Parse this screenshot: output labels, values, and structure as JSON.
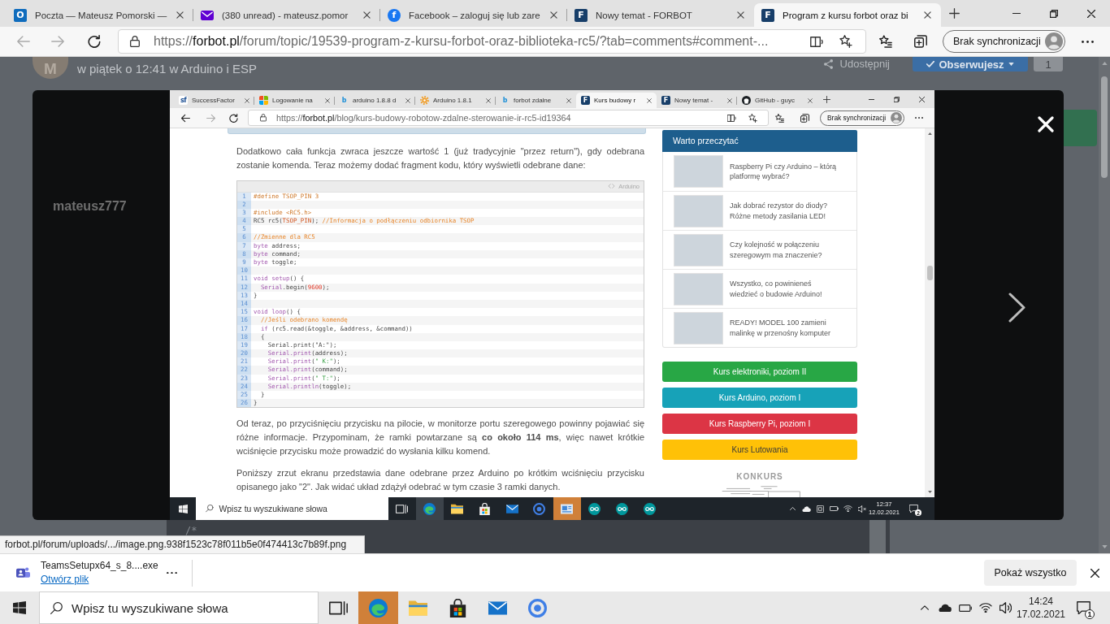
{
  "browser": {
    "tabs": [
      {
        "kind": "o-tile",
        "badge": "O",
        "title": "Poczta — Mateusz Pomorski —",
        "selected": false
      },
      {
        "kind": "envelope",
        "title": "(380 unread) - mateusz.pomor",
        "selected": false
      },
      {
        "kind": "f-circle",
        "badge": "f",
        "title": "Facebook – zaloguj się lub zare",
        "selected": false
      },
      {
        "kind": "f-tile",
        "badge": "F",
        "title": "Nowy temat - FORBOT",
        "selected": false
      },
      {
        "kind": "f-tile",
        "badge": "F",
        "title": "Program z kursu forbot oraz bi",
        "selected": true
      }
    ],
    "nav": [
      {
        "kind": "back",
        "disabled": true
      },
      {
        "kind": "forward",
        "disabled": true
      },
      {
        "kind": "refresh",
        "disabled": false
      }
    ],
    "address": {
      "scheme": "https://",
      "host": "forbot.pl",
      "path": "/forum/topic/19539-program-z-kursu-forbot-oraz-biblioteka-rc5/?tab=comments#comment-..."
    },
    "sync_button": "Brak synchronizacji"
  },
  "forum_page": {
    "avatar": "M",
    "post_meta": "w piątek o 12:41 w Arduino i ESP",
    "share": "Udostępnij",
    "follow_button": "Obserwujesz",
    "follow_count": "1",
    "username": "mateusz777",
    "code_snippet": "/*"
  },
  "lightbox": {
    "screenshot": {
      "tabs": [
        {
          "kind": "sf",
          "badge": "sf",
          "title": "SuccessFactor",
          "selected": false
        },
        {
          "kind": "windows-grid",
          "title": "Logowanie na",
          "selected": false
        },
        {
          "kind": "b-logo",
          "badge": "b",
          "title": "arduino 1.8.8 d",
          "selected": false
        },
        {
          "kind": "gear",
          "title": "Arduino 1.8.1",
          "selected": false
        },
        {
          "kind": "b-logo",
          "badge": "b",
          "title": "forbot zdalne",
          "selected": false
        },
        {
          "kind": "f-tile",
          "badge": "F",
          "title": "Kurs budowy r",
          "selected": true
        },
        {
          "kind": "f-tile",
          "badge": "F",
          "title": "Nowy temat -",
          "selected": false
        },
        {
          "kind": "cat-circle",
          "title": "GitHub - guyc",
          "selected": false
        }
      ],
      "nav": [
        {
          "kind": "back",
          "disabled": false
        },
        {
          "kind": "forward",
          "disabled": true
        },
        {
          "kind": "refresh",
          "disabled": false
        }
      ],
      "address": {
        "scheme": "https://",
        "host": "forbot.pl",
        "path": "/blog/kurs-budowy-robotow-zdalne-sterowanie-ir-rc5-id19364"
      },
      "sync_button": "Brak synchronizacji",
      "article": {
        "intro": "Dodatkowo cała funkcja zwraca jeszcze wartość 1 (już tradycyjnie \"przez return\"), gdy odebrana zostanie komenda. Teraz możemy dodać fragment kodu, który wyświetli odebrane dane:",
        "code": {
          "language": "Arduino",
          "lines": [
            {
              "n": "1",
              "tokens": [
                {
                  "kind": "preproc",
                  "text": "#define TSOP_PIN 3"
                }
              ]
            },
            {
              "n": "2"
            },
            {
              "n": "3",
              "tokens": [
                {
                  "kind": "preproc",
                  "text": "#include <RC5.h>"
                }
              ]
            },
            {
              "n": "4",
              "tokens": [
                {
                  "kind": "plain",
                  "text": "RC5 rc5("
                },
                {
                  "kind": "constant",
                  "text": "TSOP_PIN"
                },
                {
                  "kind": "plain",
                  "text": "); "
                },
                {
                  "kind": "comment",
                  "text": "//Informacja o podłączeniu odbiornika TSOP"
                }
              ]
            },
            {
              "n": "5"
            },
            {
              "n": "6",
              "tokens": [
                {
                  "kind": "comment",
                  "text": "//Zmienne dla RC5"
                }
              ]
            },
            {
              "n": "7",
              "tokens": [
                {
                  "kind": "keyword",
                  "text": "byte"
                },
                {
                  "kind": "plain",
                  "text": " address;"
                }
              ]
            },
            {
              "n": "8",
              "tokens": [
                {
                  "kind": "keyword",
                  "text": "byte"
                },
                {
                  "kind": "plain",
                  "text": " command;"
                }
              ]
            },
            {
              "n": "9",
              "tokens": [
                {
                  "kind": "keyword",
                  "text": "byte"
                },
                {
                  "kind": "plain",
                  "text": " toggle;"
                }
              ]
            },
            {
              "n": "10"
            },
            {
              "n": "11",
              "tokens": [
                {
                  "kind": "keyword",
                  "text": "void setup"
                },
                {
                  "kind": "plain",
                  "text": "() {"
                }
              ]
            },
            {
              "n": "12",
              "tokens": [
                {
                  "kind": "keyword",
                  "text": "  Serial"
                },
                {
                  "kind": "plain",
                  "text": ".begin("
                },
                {
                  "kind": "number",
                  "text": "9600"
                },
                {
                  "kind": "plain",
                  "text": ");"
                }
              ]
            },
            {
              "n": "13",
              "tokens": [
                {
                  "kind": "plain",
                  "text": "}"
                }
              ]
            },
            {
              "n": "14"
            },
            {
              "n": "15",
              "tokens": [
                {
                  "kind": "keyword",
                  "text": "void loop"
                },
                {
                  "kind": "plain",
                  "text": "() {"
                }
              ]
            },
            {
              "n": "16",
              "tokens": [
                {
                  "kind": "comment",
                  "text": "  //Jeśli odebrano komendę"
                }
              ]
            },
            {
              "n": "17",
              "tokens": [
                {
                  "kind": "keyword",
                  "text": "  if"
                },
                {
                  "kind": "plain",
                  "text": " (rc5.read(&toggle, &address, &command))"
                }
              ]
            },
            {
              "n": "18",
              "tokens": [
                {
                  "kind": "plain",
                  "text": "  {"
                }
              ]
            },
            {
              "n": "19",
              "tokens": [
                {
                  "kind": "plain",
                  "text": "    Serial.print(\"A:\");"
                }
              ]
            },
            {
              "n": "20",
              "tokens": [
                {
                  "kind": "keyword",
                  "text": "    Serial.print"
                },
                {
                  "kind": "plain",
                  "text": "(address);"
                }
              ]
            },
            {
              "n": "21",
              "tokens": [
                {
                  "kind": "keyword",
                  "text": "    Serial.print"
                },
                {
                  "kind": "plain",
                  "text": "("
                },
                {
                  "kind": "string",
                  "text": "\" K:\""
                },
                {
                  "kind": "plain",
                  "text": ");"
                }
              ]
            },
            {
              "n": "22",
              "tokens": [
                {
                  "kind": "keyword",
                  "text": "    Serial.print"
                },
                {
                  "kind": "plain",
                  "text": "(command);"
                }
              ]
            },
            {
              "n": "23",
              "tokens": [
                {
                  "kind": "keyword",
                  "text": "    Serial.print"
                },
                {
                  "kind": "plain",
                  "text": "("
                },
                {
                  "kind": "string",
                  "text": "\" T:\""
                },
                {
                  "kind": "plain",
                  "text": ");"
                }
              ]
            },
            {
              "n": "24",
              "tokens": [
                {
                  "kind": "keyword",
                  "text": "    Serial.println"
                },
                {
                  "kind": "plain",
                  "text": "(toggle);"
                }
              ]
            },
            {
              "n": "25",
              "tokens": [
                {
                  "kind": "plain",
                  "text": "  }"
                }
              ]
            },
            {
              "n": "26",
              "tokens": [
                {
                  "kind": "plain",
                  "text": "}"
                }
              ]
            }
          ]
        },
        "after": [
          "Od teraz, po przyciśnięciu przycisku na pilocie, w monitorze portu szeregowego powinny pojawiać się różne informacje. Przypominam, że ramki powtarzane są **co około 114 ms**, więc nawet krótkie wciśnięcie przycisku może prowadzić do wysłania kilku komend.",
          "Poniższy zrzut ekranu przedstawia dane odebrane przez Arduino po krótkim wciśnięciu przycisku opisanego jako \"2\". Jak widać układ zdążył odebrać w tym czasie 3 ramki danych."
        ]
      },
      "sidebar": {
        "heading": "Warto przeczytać",
        "articles": [
          {
            "title": "Raspberry Pi czy Arduino – którą platformę wybrać?"
          },
          {
            "title": "Jak dobrać rezystor do diody? Różne metody zasilania LED!"
          },
          {
            "title": "Czy kolejność w połączeniu szeregowym ma znaczenie?"
          },
          {
            "title": "Wszystko, co powinieneś wiedzieć o budowie Arduino!"
          },
          {
            "title": "READY! MODEL 100 zamieni malinkę w przenośny komputer"
          }
        ],
        "courses": [
          {
            "label": "Kurs elektroniki, poziom II",
            "color": "#28a745"
          },
          {
            "label": "Kurs Arduino, poziom I",
            "color": "#17a2b8"
          },
          {
            "label": "Kurs Raspberry Pi, poziom I",
            "color": "#dc3545"
          },
          {
            "label": "Kurs Lutowania",
            "color": "#ffc107"
          }
        ],
        "contest": "KONKURS"
      },
      "taskbar": {
        "search_placeholder": "Wpisz tu wyszukiwane słowa",
        "apps": [
          {
            "kind": "task-view",
            "active": false,
            "flashing": false
          },
          {
            "kind": "edge",
            "active": true,
            "flashing": false
          },
          {
            "kind": "folder",
            "active": false,
            "flashing": false
          },
          {
            "kind": "store",
            "active": false,
            "flashing": false
          },
          {
            "kind": "mail",
            "active": false,
            "flashing": false
          },
          {
            "kind": "chrome",
            "active": false,
            "flashing": false
          },
          {
            "kind": "photo-app",
            "active": false,
            "flashing": true
          },
          {
            "kind": "arduino",
            "active": false,
            "flashing": false
          },
          {
            "kind": "arduino",
            "active": false,
            "flashing": false
          },
          {
            "kind": "arduino",
            "active": false,
            "flashing": false
          }
        ],
        "time": "12:37",
        "date": "12.02.2021",
        "notifications": "2"
      }
    }
  },
  "status_link": "forbot.pl/forum/uploads/.../image.png.938f1523c78f011b5e0f474413c7b89f.png",
  "downloads": {
    "file": "TeamsSetupx64_s_8....exe",
    "open_link": "Otwórz plik",
    "show_all": "Pokaż wszystko"
  },
  "taskbar": {
    "search_placeholder": "Wpisz tu wyszukiwane słowa",
    "apps": [
      {
        "kind": "task-view",
        "flashing": false
      },
      {
        "kind": "edge",
        "flashing": true
      },
      {
        "kind": "folder",
        "flashing": false
      },
      {
        "kind": "store",
        "flashing": false
      },
      {
        "kind": "mail",
        "flashing": false
      },
      {
        "kind": "chrome",
        "flashing": false
      }
    ],
    "time": "14:24",
    "date": "17.02.2021",
    "notifications": "1"
  }
}
